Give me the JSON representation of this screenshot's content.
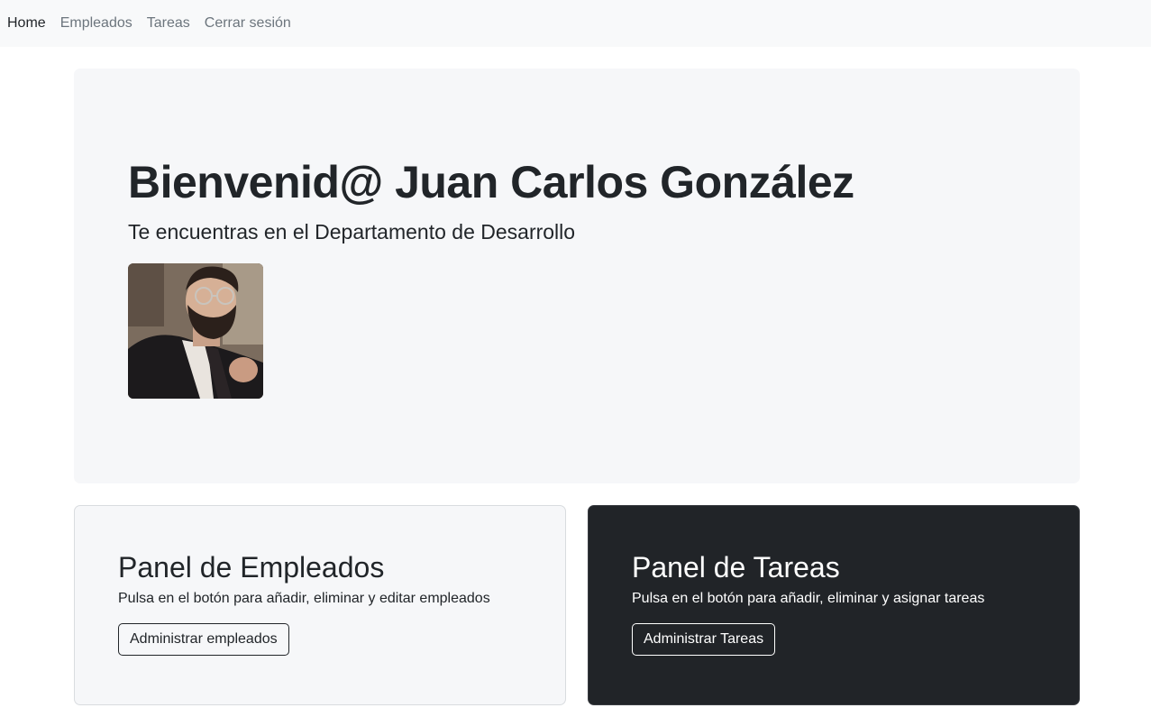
{
  "nav": {
    "items": [
      {
        "label": "Home",
        "active": true
      },
      {
        "label": "Empleados",
        "active": false
      },
      {
        "label": "Tareas",
        "active": false
      },
      {
        "label": "Cerrar sesión",
        "active": false
      }
    ]
  },
  "hero": {
    "title": "Bienvenid@ Juan Carlos González",
    "subtitle": "Te encuentras en el Departamento de Desarrollo",
    "avatar_icon": "user-photo"
  },
  "panels": [
    {
      "title": "Panel de Empleados",
      "text": "Pulsa en el botón para añadir, eliminar y editar empleados",
      "button": "Administrar empleados",
      "theme": "light"
    },
    {
      "title": "Panel de Tareas",
      "text": "Pulsa en el botón para añadir, eliminar y asignar tareas",
      "button": "Administrar Tareas",
      "theme": "dark"
    }
  ],
  "colors": {
    "nav_bg": "#f8f9fa",
    "panel_light_bg": "#f6f7f9",
    "panel_dark_bg": "#212428",
    "text": "#212529",
    "muted": "#6c757d"
  }
}
